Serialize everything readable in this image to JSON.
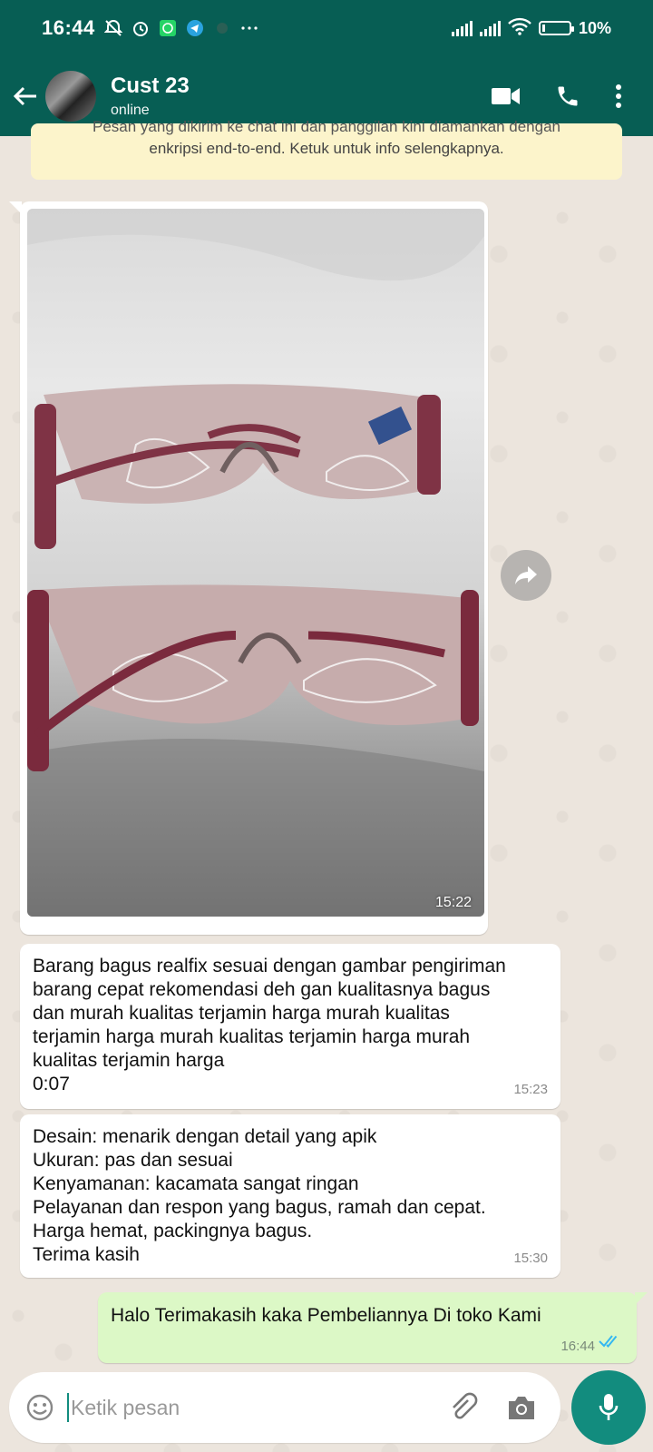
{
  "status_bar": {
    "time": "16:44",
    "battery_text": "10%",
    "battery_level": 0.1
  },
  "app_bar": {
    "contact_name": "Cust 23",
    "contact_status": "online"
  },
  "encryption_notice": {
    "line1": "Pesan yang dikirim ke chat ini dan panggilan kini diamankan dengan",
    "line2": "enkripsi end-to-end. Ketuk untuk info selengkapnya."
  },
  "messages": [
    {
      "type": "image",
      "direction": "incoming",
      "time": "15:22"
    },
    {
      "type": "text",
      "direction": "incoming",
      "text": "Barang bagus realfix sesuai dengan gambar pengiriman\nbarang cepat rekomendasi deh gan kualitasnya bagus\ndan murah kualitas terjamin harga murah kualitas\nterjamin harga murah kualitas terjamin harga murah\nkualitas terjamin harga\n0:07",
      "time": "15:23"
    },
    {
      "type": "text",
      "direction": "incoming",
      "text": "Desain: menarik dengan detail yang apik\nUkuran: pas dan sesuai\nKenyamanan: kacamata sangat ringan\nPelayanan dan respon yang bagus, ramah dan cepat.\nHarga hemat, packingnya bagus.\nTerima kasih",
      "time": "15:30"
    },
    {
      "type": "text",
      "direction": "outgoing",
      "text": "Halo Terimakasih kaka Pembeliannya  Di toko Kami",
      "time": "16:44",
      "read": true
    }
  ],
  "composer": {
    "placeholder": "Ketik pesan"
  },
  "colors": {
    "header": "#075e54",
    "accent": "#128c7e",
    "outgoing_bubble": "#dcf8c6",
    "read_tick": "#34b7f1"
  },
  "icons": [
    "back-arrow-icon",
    "video-call-icon",
    "phone-call-icon",
    "more-options-icon",
    "forward-icon",
    "emoji-icon",
    "attach-icon",
    "camera-icon",
    "mic-icon",
    "double-tick-icon"
  ]
}
